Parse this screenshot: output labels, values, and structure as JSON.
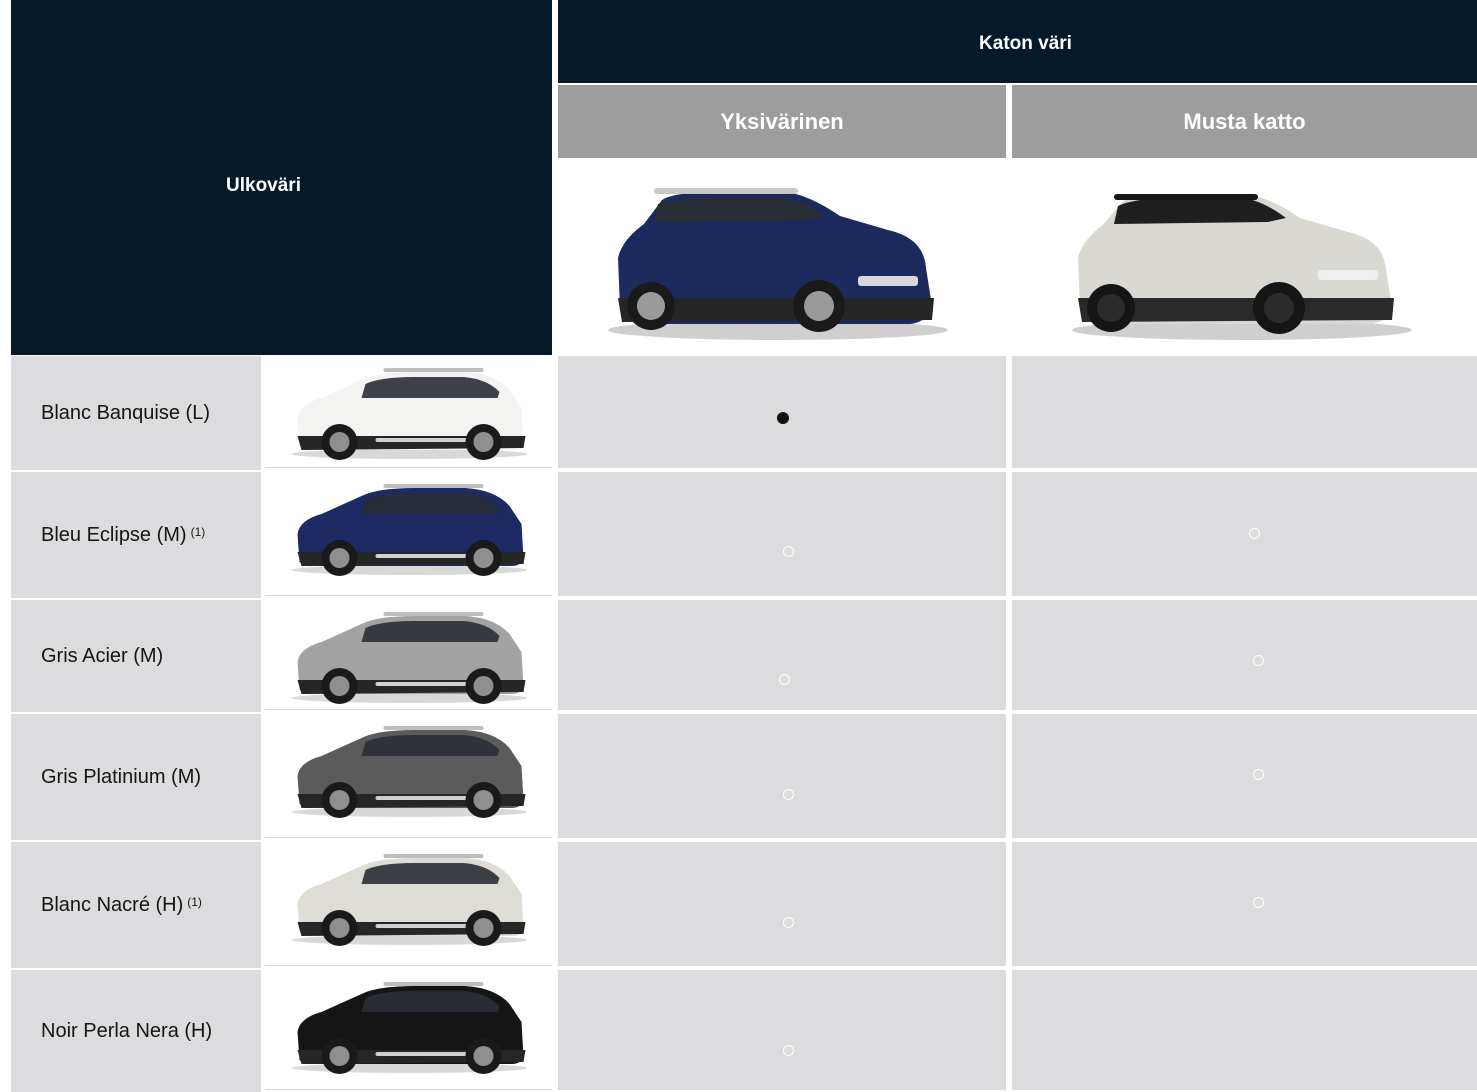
{
  "header": {
    "exterior_label": "Ulkoväri",
    "roof_label": "Katon väri",
    "col_mono": "Yksivärinen",
    "col_black_roof": "Musta katto",
    "mono_car_color": "#1c2a5e",
    "black_roof_car_color": "#d9d8d3"
  },
  "rows": [
    {
      "name": "Blanc Banquise (L)",
      "note": "",
      "car_color": "#f3f3f1",
      "mono": "standard",
      "black_roof": ""
    },
    {
      "name": "Bleu Eclipse (M)",
      "note": "(1)",
      "car_color": "#1d2a63",
      "mono": "option",
      "black_roof": "option"
    },
    {
      "name": "Gris Acier (M)",
      "note": "",
      "car_color": "#a3a3a3",
      "mono": "option",
      "black_roof": "option"
    },
    {
      "name": "Gris Platinium (M)",
      "note": "",
      "car_color": "#5b5b5c",
      "mono": "option",
      "black_roof": "option"
    },
    {
      "name": "Blanc Nacré (H)",
      "note": "(1)",
      "car_color": "#dedcd6",
      "mono": "option",
      "black_roof": "option"
    },
    {
      "name": "Noir Perla Nera (H)",
      "note": "",
      "car_color": "#151515",
      "mono": "option",
      "black_roof": ""
    }
  ]
}
